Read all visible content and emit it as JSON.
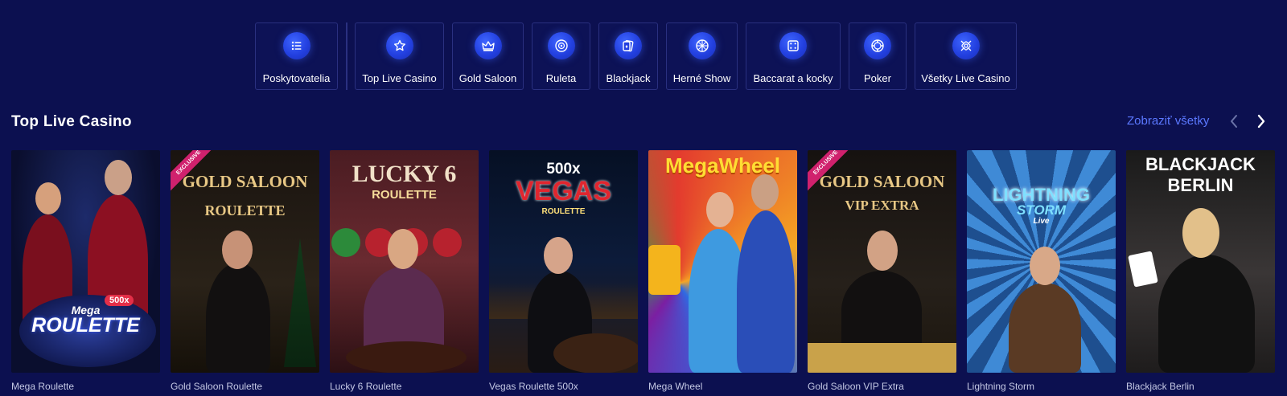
{
  "categories": [
    {
      "label": "Poskytovatelia",
      "icon": "list-icon"
    },
    {
      "label": "Top Live Casino",
      "icon": "star-icon"
    },
    {
      "label": "Gold Saloon",
      "icon": "crown-icon"
    },
    {
      "label": "Ruleta",
      "icon": "roulette-icon"
    },
    {
      "label": "Blackjack",
      "icon": "cards-icon"
    },
    {
      "label": "Herné Show",
      "icon": "wheel-icon"
    },
    {
      "label": "Baccarat a kocky",
      "icon": "dice-icon"
    },
    {
      "label": "Poker",
      "icon": "chip-icon"
    },
    {
      "label": "Všetky Live Casino",
      "icon": "all-games-icon"
    }
  ],
  "section": {
    "title": "Top Live Casino",
    "view_all": "Zobraziť všetky"
  },
  "colors": {
    "background": "#0c1050",
    "accent": "#5b78ff",
    "icon_blue": "#2340e0",
    "exclusive_badge": "#d0216d"
  },
  "games": [
    {
      "name": "Mega Roulette",
      "logo_line1": "Mega",
      "logo_line2": "ROULETTE",
      "multiplier": "500x",
      "badge": ""
    },
    {
      "name": "Gold Saloon Roulette",
      "logo_line1": "GOLD SALOON",
      "logo_line2": "ROULETTE",
      "badge": "EXCLUSIVE"
    },
    {
      "name": "Lucky 6 Roulette",
      "logo_line1": "LUCKY 6",
      "logo_line2": "ROULETTE",
      "badge": ""
    },
    {
      "name": "Vegas Roulette 500x",
      "logo_line1": "500x",
      "logo_line2": "VEGAS",
      "logo_line3": "ROULETTE",
      "badge": ""
    },
    {
      "name": "Mega Wheel",
      "logo_line1": "MegaWheel",
      "badge": ""
    },
    {
      "name": "Gold Saloon VIP Extra",
      "logo_line1": "GOLD SALOON",
      "logo_line2": "VIP EXTRA",
      "badge": "EXCLUSIVE"
    },
    {
      "name": "Lightning Storm",
      "logo_line1": "LIGHTNING",
      "logo_line2": "STORM",
      "logo_line3": "Live",
      "badge": ""
    },
    {
      "name": "Blackjack Berlin",
      "logo_line1": "BLACKJACK",
      "logo_line2": "BERLIN",
      "badge": ""
    }
  ]
}
